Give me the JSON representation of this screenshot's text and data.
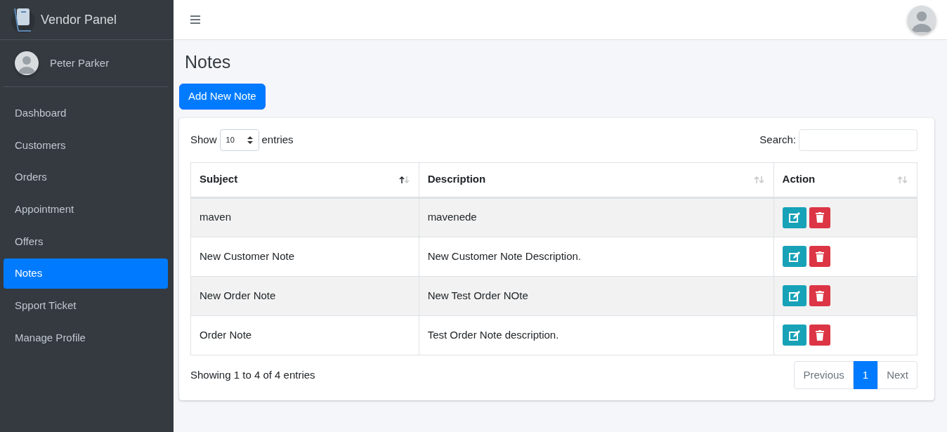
{
  "brand": {
    "title": "Vendor Panel"
  },
  "user": {
    "name": "Peter Parker"
  },
  "sidebar": {
    "items": [
      {
        "label": "Dashboard",
        "selected": false
      },
      {
        "label": "Customers",
        "selected": false
      },
      {
        "label": "Orders",
        "selected": false
      },
      {
        "label": "Appointment",
        "selected": false
      },
      {
        "label": "Offers",
        "selected": false
      },
      {
        "label": "Notes",
        "selected": true
      },
      {
        "label": "Spport Ticket",
        "selected": false
      },
      {
        "label": "Manage Profile",
        "selected": false
      }
    ]
  },
  "page": {
    "title": "Notes",
    "add_button": "Add New Note"
  },
  "table_controls": {
    "show_label": "Show",
    "page_size": "10",
    "entries_label": "entries",
    "search_label": "Search:"
  },
  "table": {
    "columns": [
      {
        "label": "Subject",
        "sorted_ascending": true
      },
      {
        "label": "Description",
        "sorted_ascending": false
      },
      {
        "label": "Action",
        "sorted_ascending": false
      }
    ],
    "rows": [
      {
        "subject": "maven",
        "description": "mavenede"
      },
      {
        "subject": "New Customer Note",
        "description": "New Customer Note Description."
      },
      {
        "subject": "New Order Note",
        "description": "New Test Order NOte"
      },
      {
        "subject": "Order Note",
        "description": "Test Order Note description."
      }
    ]
  },
  "footer": {
    "info": "Showing 1 to 4 of 4 entries"
  },
  "pagination": [
    {
      "label": "Previous",
      "selected": false,
      "disabled": true
    },
    {
      "label": "1",
      "selected": true,
      "disabled": false
    },
    {
      "label": "Next",
      "selected": false,
      "disabled": true
    }
  ]
}
